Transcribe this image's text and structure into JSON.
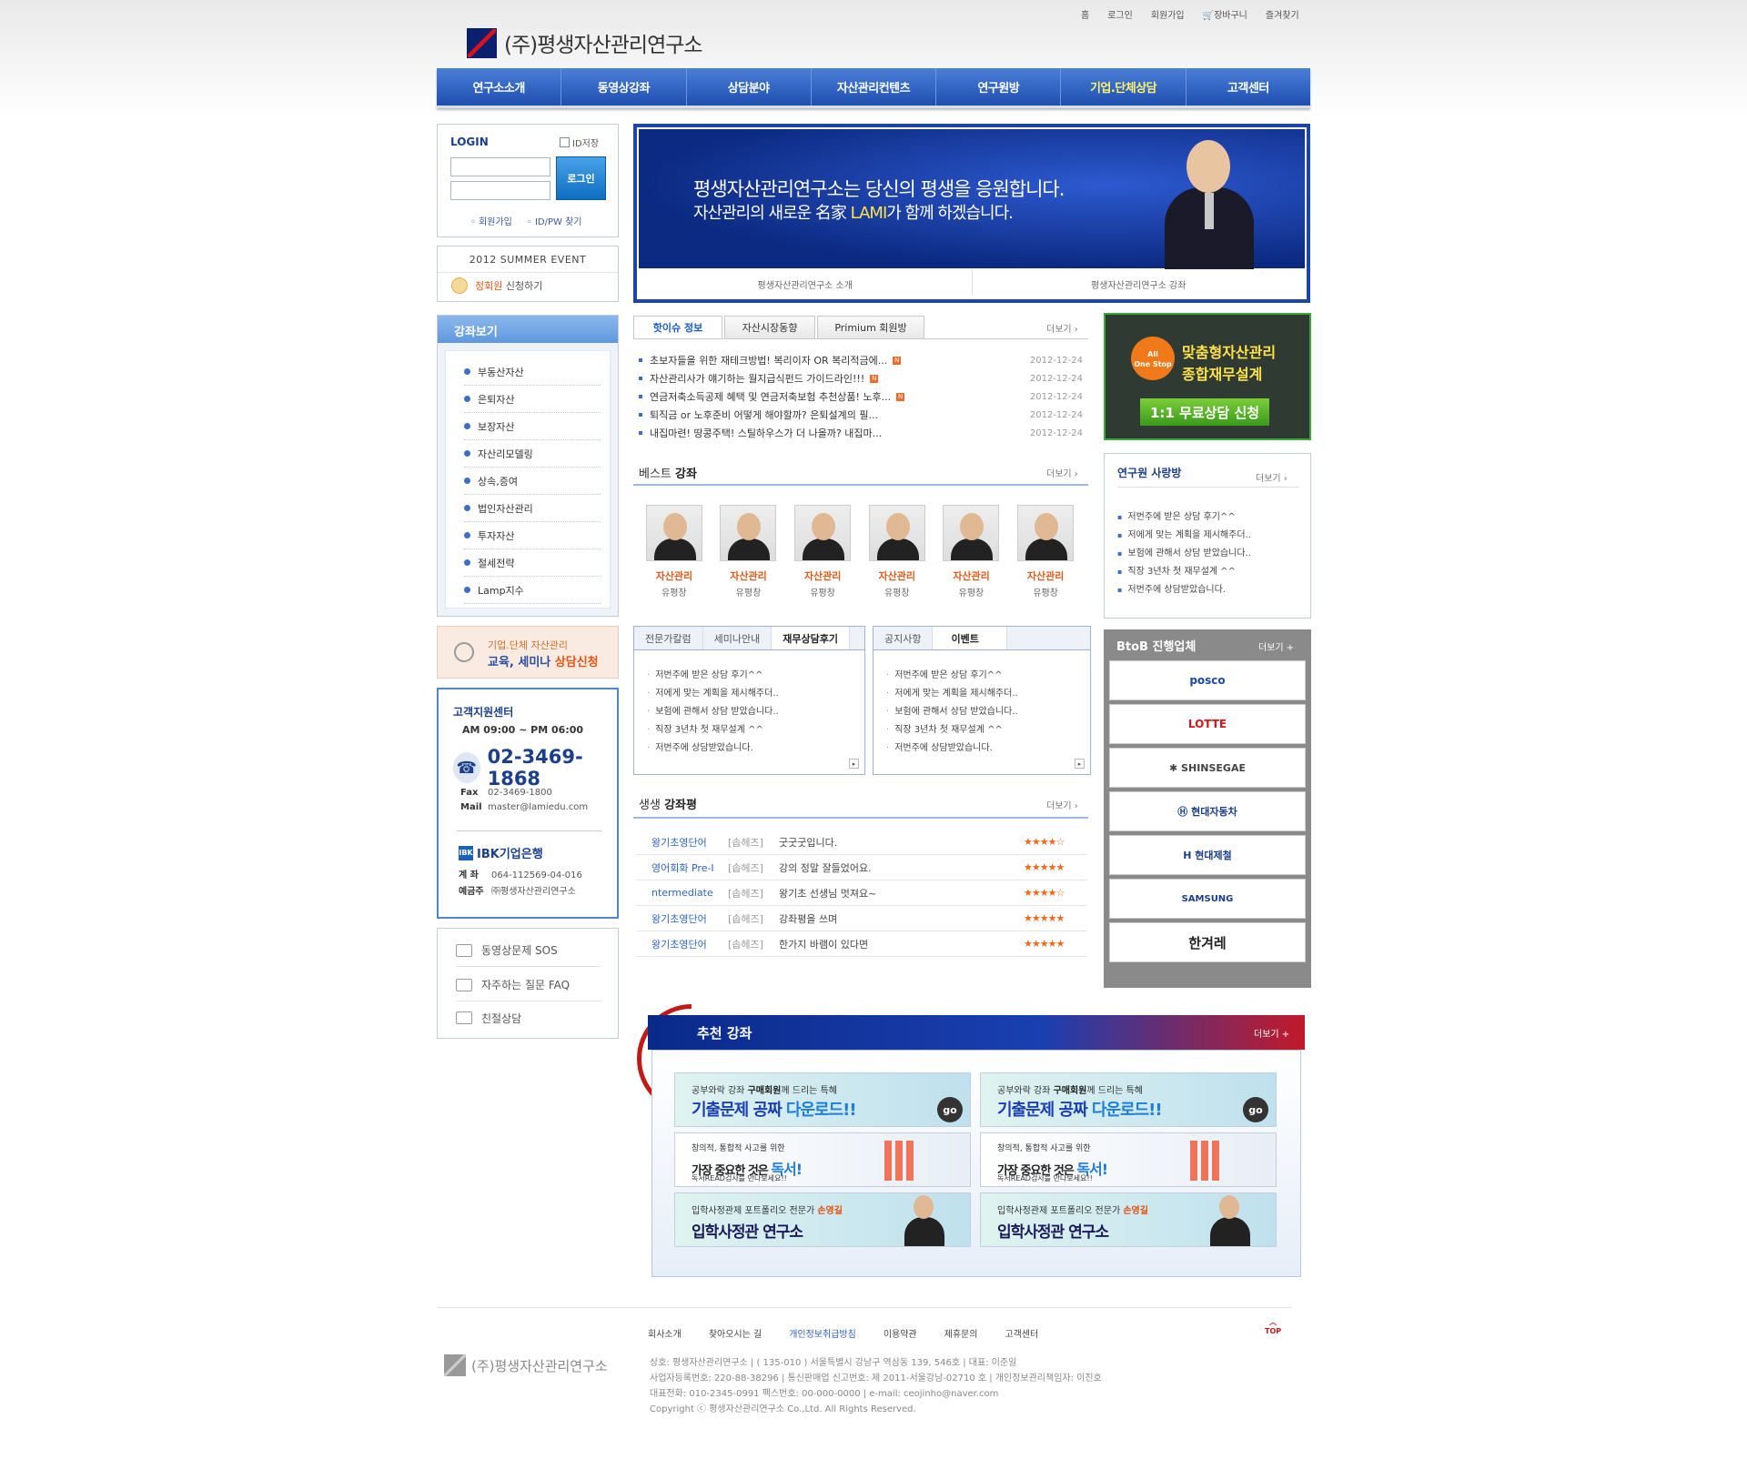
{
  "util": [
    "홈",
    "로그인",
    "회원가입",
    "장바구니",
    "즐겨찾기"
  ],
  "brand": "(주)평생자산관리연구소",
  "gnb": [
    {
      "label": "연구소소개",
      "hl": false
    },
    {
      "label": "동영상강좌",
      "hl": false
    },
    {
      "label": "상담분야",
      "hl": false
    },
    {
      "label": "자산관리컨텐츠",
      "hl": false
    },
    {
      "label": "연구원방",
      "hl": false
    },
    {
      "label": "기업.단체상담",
      "hl": true
    },
    {
      "label": "고객센터",
      "hl": false
    }
  ],
  "login": {
    "title": "LOGIN",
    "save_id": "ID저장",
    "button": "로그인",
    "join": "회원가입",
    "find": "ID/PW 찾기"
  },
  "event": {
    "title": "2012 SUMMER EVENT",
    "member": "정회원",
    "apply": "신청하기"
  },
  "lecture": {
    "title": "강좌보기",
    "items": [
      "부동산자산",
      "은퇴자산",
      "보장자산",
      "자산리모델링",
      "상속,증여",
      "법인자산관리",
      "투자자산",
      "절세전략",
      "Lamp지수"
    ]
  },
  "seminar": {
    "line1": "기업.단체 자산관리",
    "line2a": "교육, 세미나 ",
    "line2b": "상담신청"
  },
  "cs": {
    "title": "고객지원센터",
    "hours": "AM 09:00 ~ PM 06:00",
    "phone": "02-3469-1868",
    "fax_label": "Fax",
    "fax": "02-3469-1800",
    "mail_label": "Mail",
    "mail": "master@lamiedu.com",
    "bank": "IBK기업은행",
    "acc_label": "계 좌",
    "acc": "064-112569-04-016",
    "holder_label": "예금주",
    "holder": "㈜평생자산관리연구소"
  },
  "quick": [
    "동영상문제 SOS",
    "자주하는 질문 FAQ",
    "친절상담"
  ],
  "banner": {
    "line1": "평생자산관리연구소는 당신의 평생을 응원합니다.",
    "line2a": "자산관리의 새로운 名家 ",
    "line2b": "LAMI",
    "line2c": "가 함께 하겠습니다.",
    "tab1": "평생자산관리연구소 소개",
    "tab2": "평생자산관리연구소 강좌"
  },
  "news": {
    "tabs": [
      "핫이슈 정보",
      "자산시장동향",
      "Primium 회원방"
    ],
    "more": "더보기 ›",
    "items": [
      {
        "title": "초보자들을 위한 재테크방법! 복리이자 OR 복리적금에...",
        "date": "2012-12-24",
        "new": true
      },
      {
        "title": "자산관리사가 얘기하는 월지급식펀드 가이드라인!!!",
        "date": "2012-12-24",
        "new": true
      },
      {
        "title": "연금저축소득공제 혜택 및 연금저축보험 추천상품! 노후...",
        "date": "2012-12-24",
        "new": true
      },
      {
        "title": "퇴직금 or 노후준비 어떻게 해야할까? 은퇴설계의 필...",
        "date": "2012-12-24",
        "new": false
      },
      {
        "title": "내집마련! 땅콩주택! 스틸하우스가 더 나을까? 내집마...",
        "date": "2012-12-24",
        "new": false
      }
    ]
  },
  "best": {
    "title_a": "베스트 ",
    "title_b": "강좌",
    "more": "더보기 ›",
    "profs": [
      {
        "cat": "자산관리",
        "name": "유평창"
      },
      {
        "cat": "자산관리",
        "name": "유평창"
      },
      {
        "cat": "자산관리",
        "name": "유평창"
      },
      {
        "cat": "자산관리",
        "name": "유평창"
      },
      {
        "cat": "자산관리",
        "name": "유평창"
      },
      {
        "cat": "자산관리",
        "name": "유평창"
      }
    ]
  },
  "box1": {
    "tabs": [
      "전문가칼럼",
      "세미나안내",
      "재무상담후기"
    ],
    "items": [
      "저번주에 받은 상담 후기^^",
      "저에게 맞는 계획을 제시해주더..",
      "보험에 관해서 상담 받았습니다..",
      "직장 3년차 첫 재무설계 ^^",
      "저번주에 상담받았습니다."
    ]
  },
  "box2": {
    "tabs": [
      "공지사항",
      "이벤트"
    ],
    "items": [
      "저번주에 받은 상담 후기^^",
      "저에게 맞는 계획을 제시해주더..",
      "보험에 관해서 상담 받았습니다..",
      "직장 3년차 첫 재무설계 ^^",
      "저번주에 상담받았습니다."
    ]
  },
  "reviews": {
    "title_a": "생생 ",
    "title_b": "강좌평",
    "more": "더보기 ›",
    "items": [
      {
        "course": "왕기초영단어",
        "who": "[솝헤즈]",
        "text": "굿굿굿입니다.",
        "stars": "★★★★☆"
      },
      {
        "course": "영어회화 Pre-I",
        "who": "[솝헤즈]",
        "text": "강의 정말 잘들었어요.",
        "stars": "★★★★★"
      },
      {
        "course": "ntermediate",
        "who": "[솝헤즈]",
        "text": "왕기초 선생님 멋져요~",
        "stars": "★★★★☆"
      },
      {
        "course": "왕기초영단어",
        "who": "[솝헤즈]",
        "text": "강좌평을 쓰며",
        "stars": "★★★★★"
      },
      {
        "course": "왕기초영단어",
        "who": "[솝헤즈]",
        "text": "한가지 바램이 있다면",
        "stars": "★★★★★"
      }
    ]
  },
  "onestop": {
    "badge1": "All",
    "badge2": "One Stop",
    "t1": "맞춤형자산관리",
    "t2": "종합재무설계",
    "button": "1:1 무료상담 신청"
  },
  "love": {
    "title": "연구원 사랑방",
    "more": "더보기 ›",
    "items": [
      "저번주에 받은 상담 후기^^",
      "저에게 맞는 계획을 제시해주더..",
      "보험에 관해서 상담 받았습니다..",
      "직장 3년차 첫 재무설계 ^^",
      "저번주에 상담받았습니다."
    ]
  },
  "btob": {
    "title": "BtoB 진행업체",
    "more": "더보기 +",
    "logos": [
      {
        "name": "posco",
        "color": "#1a4aa8"
      },
      {
        "name": "LOTTE",
        "color": "#d8131b"
      },
      {
        "name": "✱ SHINSEGAE",
        "color": "#444"
      },
      {
        "name": "Ⓗ 현대자동차",
        "color": "#1a3f8a"
      },
      {
        "name": "H 현대제철",
        "color": "#1a3f8a"
      },
      {
        "name": "SAMSUNG",
        "color": "#1a3f8a"
      },
      {
        "name": "한겨레",
        "color": "#222"
      }
    ]
  },
  "rec": {
    "title": "추천 강좌",
    "more": "더보기 +",
    "card1": {
      "l1a": "공부와락 강좌 ",
      "l1b": "구매회원",
      "l1c": "께 드리는 특혜",
      "l2a": "기출문제 공짜 ",
      "l2b": "다운로드!!",
      "go": "go"
    },
    "card2": {
      "l1": "창의적, 통합적 사고",
      "l1s": "를 위한",
      "l2a": "가장 중요한 것은 ",
      "l2b": "독서!",
      "l3": "독서READ검사를 만나보세요!!"
    },
    "card3": {
      "l1a": "입학사정관제 포트폴리오 전문가 ",
      "l1b": "손영길",
      "l2": "입학사정관 연구소"
    }
  },
  "footer": {
    "nav": [
      "회사소개",
      "찾아오시는 길",
      "개인정보취급방침",
      "이용약관",
      "제휴문의",
      "고객센터"
    ],
    "top": "TOP",
    "brand": "(주)평생자산관리연구소",
    "lines": [
      "상호: 평생자산관리연구소 | ( 135-010 ) 서울특별시 강남구 역삼동 139, 546호 | 대표: 이준일",
      "사업자등록번호: 220-88-38296 | 통신판매업 신고번호: 제 2011-서울강남-02710 호 | 개인정보관리책임자: 이진호",
      "대표전화: 010-2345-0991  팩스번호: 00-000-0000 | e-mail: ceojinho@naver.com",
      "Copyright ⓒ 평생자산관리연구소 Co.,Ltd. All Rights Reserved."
    ]
  }
}
